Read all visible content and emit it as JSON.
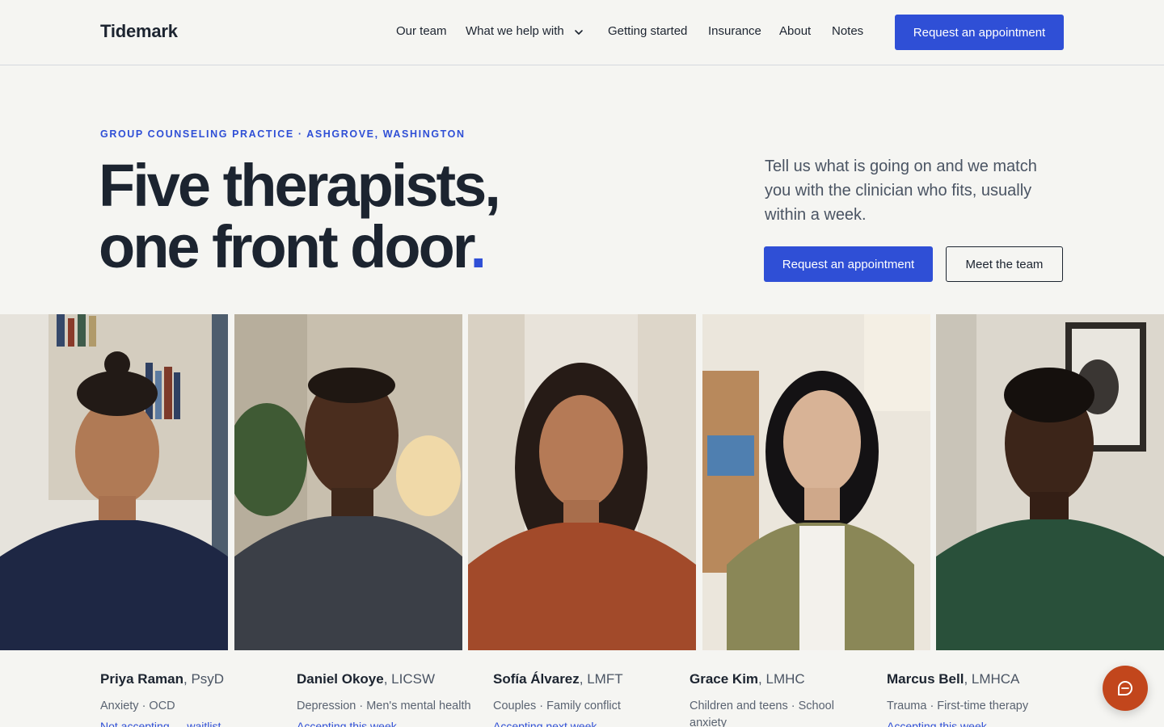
{
  "header": {
    "logo": "Tidemark",
    "nav": [
      "Our team",
      "What we help with",
      "Getting started",
      "Insurance",
      "About",
      "Notes"
    ],
    "cta": "Request an appointment"
  },
  "hero": {
    "eyebrow": "GROUP COUNSELING PRACTICE · ASHGROVE, WASHINGTON",
    "headline_line1": "Five therapists,",
    "headline_line2": "one front door",
    "headline_dot": ".",
    "lede": "Tell us what is going on and we match you with the clinician who fits, usually within a week.",
    "primary_cta": "Request an appointment",
    "secondary_cta": "Meet the team"
  },
  "therapists": [
    {
      "name": "Priya Raman",
      "credential": ", PsyD",
      "specialties": "Anxiety · OCD",
      "status": "Not accepting — waitlist"
    },
    {
      "name": "Daniel Okoye",
      "credential": ", LICSW",
      "specialties": "Depression · Men's mental health",
      "status": "Accepting this week"
    },
    {
      "name": "Sofía Álvarez",
      "credential": ", LMFT",
      "specialties": "Couples · Family conflict",
      "status": "Accepting next week"
    },
    {
      "name": "Grace Kim",
      "credential": ", LMHC",
      "specialties": "Children and teens · School anxiety",
      "status": ""
    },
    {
      "name": "Marcus Bell",
      "credential": ", LMHCA",
      "specialties": "Trauma · First-time therapy",
      "status": "Accepting this week"
    }
  ],
  "colors": {
    "accent": "#2f4fd6",
    "ink": "#1c2430",
    "background": "#f5f5f2",
    "chat": "#c2461c"
  },
  "icons": {
    "nav_dropdown": "chevron-down-icon",
    "chat": "chat-bubble-icon"
  }
}
